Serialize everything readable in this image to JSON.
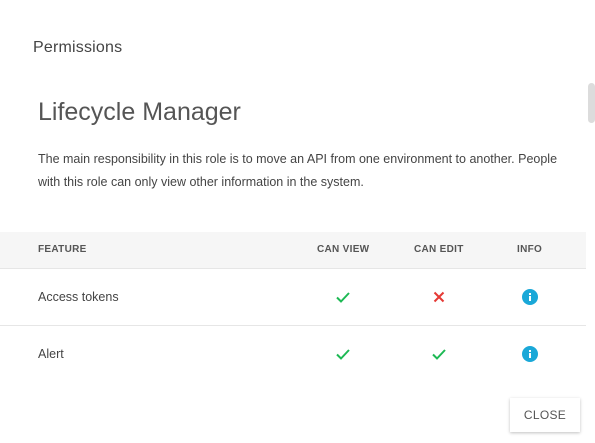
{
  "dialog": {
    "title": "Permissions",
    "close_label": "CLOSE"
  },
  "role": {
    "name": "Lifecycle Manager",
    "description": "The main responsibility in this role is to move an API from one environment to another. People with this role can only view other information in the system."
  },
  "table": {
    "headers": {
      "feature": "FEATURE",
      "can_view": "CAN VIEW",
      "can_edit": "CAN EDIT",
      "info": "INFO"
    },
    "rows": [
      {
        "feature": "Access tokens",
        "can_view": true,
        "can_edit": false
      },
      {
        "feature": "Alert",
        "can_view": true,
        "can_edit": true
      }
    ]
  },
  "colors": {
    "check": "#1db954",
    "cross": "#e53935",
    "info": "#1aa8d8"
  }
}
